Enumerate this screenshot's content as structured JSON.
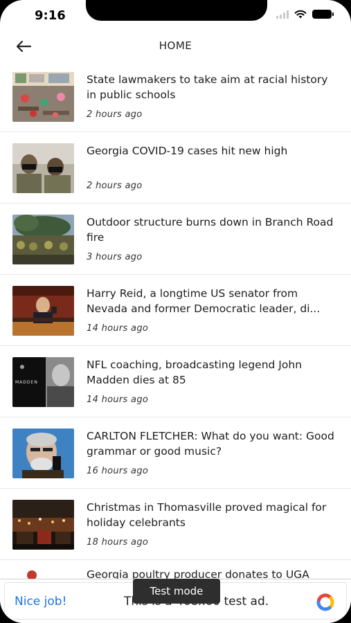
{
  "status": {
    "time": "9:16"
  },
  "header": {
    "title": "HOME"
  },
  "articles": [
    {
      "title": "State lawmakers to take aim at racial history in public schools",
      "time": "2 hours ago"
    },
    {
      "title": "Georgia COVID-19 cases hit new high",
      "time": "2 hours ago"
    },
    {
      "title": "Outdoor structure burns down in Branch Road fire",
      "time": "3 hours ago"
    },
    {
      "title": "Harry Reid, a longtime US senator from Nevada and former Democratic leader, di...",
      "time": "14 hours ago"
    },
    {
      "title": "NFL coaching, broadcasting legend John Madden dies at 85",
      "time": "14 hours ago"
    },
    {
      "title": "CARLTON FLETCHER: What do you want: Good grammar or good music?",
      "time": "16 hours ago"
    },
    {
      "title": "Christmas in Thomasville proved magical for holiday celebrants",
      "time": "18 hours ago"
    },
    {
      "title": "Georgia poultry producer donates to UGA"
    }
  ],
  "thumb_text": {
    "madden": "MADDEN"
  },
  "ad": {
    "nice_job": "Nice job!",
    "text": "This is a 468x60 test ad.",
    "test_mode": "Test mode"
  },
  "colors": {
    "accent": "#1a73e8"
  },
  "icons": {
    "back": "back-arrow-icon",
    "wifi": "wifi-icon",
    "battery": "battery-icon",
    "ad_logo": "ad-choices-logo"
  }
}
